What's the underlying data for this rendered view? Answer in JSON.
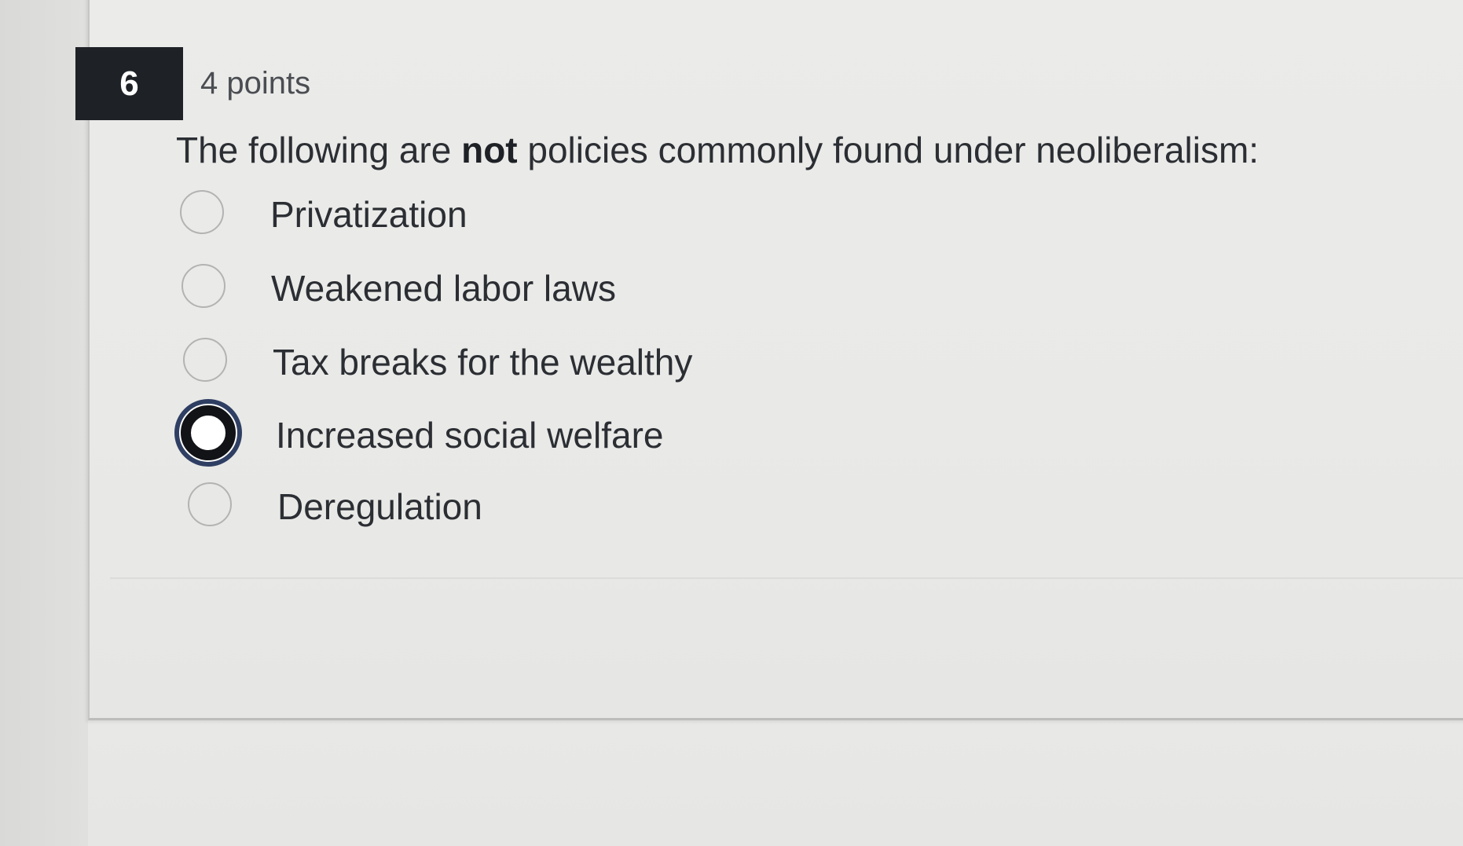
{
  "question": {
    "number": "6",
    "points": "4 points",
    "prompt_before": "The following are ",
    "prompt_emphasis": "not",
    "prompt_after": " policies commonly found under neoliberalism:"
  },
  "options": [
    {
      "label": "Privatization",
      "selected": false
    },
    {
      "label": "Weakened labor laws",
      "selected": false
    },
    {
      "label": "Tax breaks for the wealthy",
      "selected": false
    },
    {
      "label": "Increased social welfare",
      "selected": true
    },
    {
      "label": "Deregulation",
      "selected": false
    }
  ],
  "colors": {
    "question_badge": "#1e2126",
    "selected_radio_ring": "#2f3f63",
    "text": "#2b2e33"
  }
}
